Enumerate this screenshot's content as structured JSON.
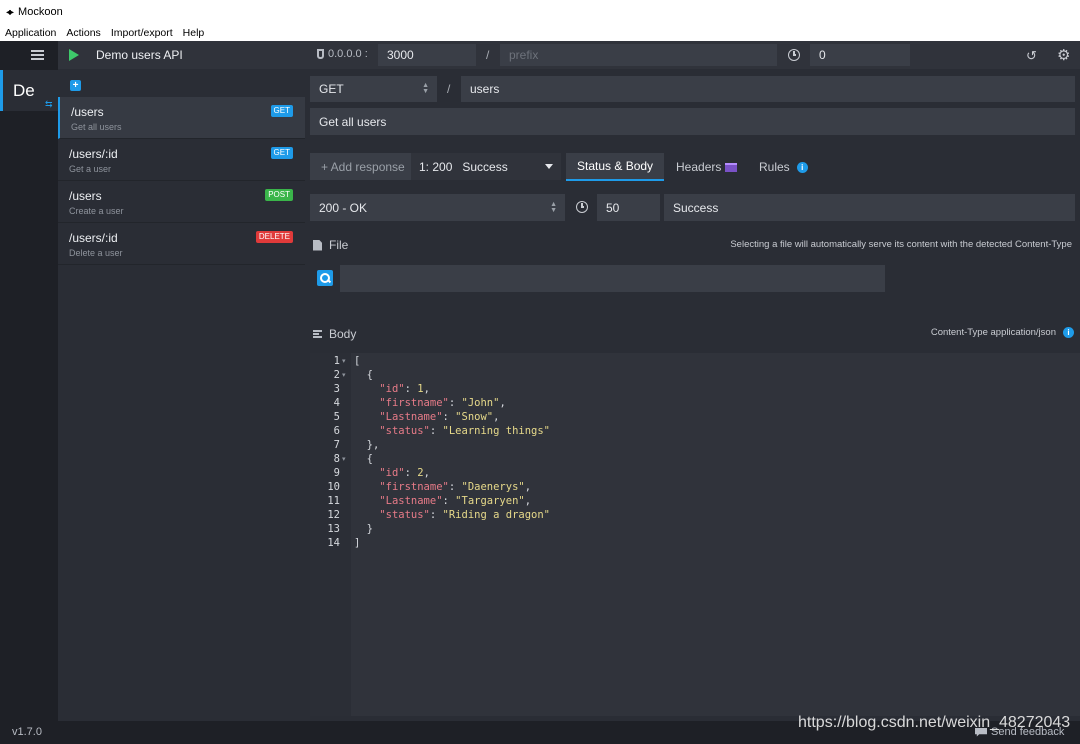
{
  "window": {
    "title": "Mockoon",
    "logo": "mockoon-logo-icon"
  },
  "menubar": [
    "Application",
    "Actions",
    "Import/export",
    "Help"
  ],
  "environments": {
    "active_short": "De"
  },
  "environment": {
    "name": "Demo users API",
    "play_icon": "play-icon"
  },
  "routes": [
    {
      "path": "/users",
      "description": "Get all users",
      "method": "GET",
      "color": "#1e9be9",
      "active": true
    },
    {
      "path": "/users/:id",
      "description": "Get a user",
      "method": "GET",
      "color": "#1e9be9",
      "active": false
    },
    {
      "path": "/users",
      "description": "Create a user",
      "method": "POST",
      "color": "#3ab54a",
      "active": false
    },
    {
      "path": "/users/:id",
      "description": "Delete a user",
      "method": "DELETE",
      "color": "#e03a3a",
      "active": false
    }
  ],
  "topbar": {
    "host": "0.0.0.0 :",
    "port": "3000",
    "slash": "/",
    "prefix_placeholder": "prefix",
    "latency": "0"
  },
  "route_settings": {
    "method": "GET",
    "slash": "/",
    "path": "users",
    "description": "Get all users"
  },
  "response": {
    "add_label": "+ Add response",
    "selected": "1: 200   Success",
    "tabs": {
      "status_body": "Status & Body",
      "headers": "Headers",
      "rules": "Rules"
    },
    "status": "200 - OK",
    "latency": "50",
    "label": "Success"
  },
  "file": {
    "label": "File",
    "hint": "Selecting a file will automatically serve its content with the detected Content-Type"
  },
  "body": {
    "label": "Body",
    "content_type": "Content-Type application/json",
    "lines": [
      "[",
      "  {",
      "    \"id\": 1,",
      "    \"firstname\": \"John\",",
      "    \"Lastname\": \"Snow\",",
      "    \"status\": \"Learning things\"",
      "  },",
      "  {",
      "    \"id\": 2,",
      "    \"firstname\": \"Daenerys\",",
      "    \"Lastname\": \"Targaryen\",",
      "    \"status\": \"Riding a dragon\"",
      "  }",
      "]"
    ]
  },
  "statusbar": {
    "version": "v1.7.0",
    "feedback": "Send feedback"
  },
  "watermark": "https://blog.csdn.net/weixin_48272043",
  "colors": {
    "accent": "#1e9be9",
    "get": "#1e9be9",
    "post": "#3ab54a",
    "delete": "#e03a3a",
    "play": "#3ec96a"
  }
}
